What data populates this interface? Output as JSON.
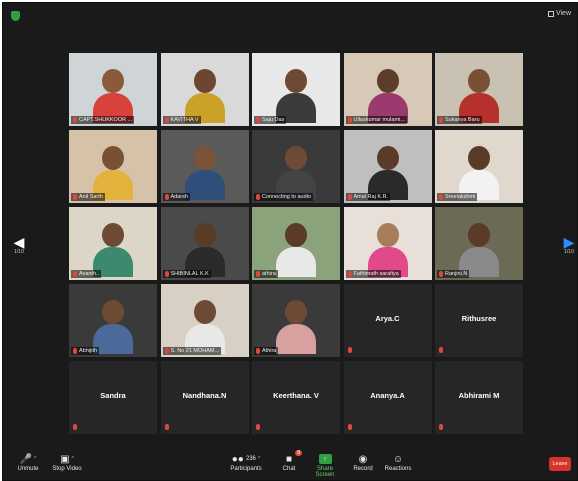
{
  "topbar": {
    "view_label": "View"
  },
  "page": {
    "left_indicator": "1/10",
    "right_indicator": "1/10"
  },
  "tiles": [
    {
      "name": "CAPT.SHUKKOOR ...",
      "kind": "video",
      "bg": "#cfd4d6",
      "skin": "#8a5a3b",
      "shirt": "#d9413b"
    },
    {
      "name": "KAVITHA V",
      "kind": "video",
      "bg": "#d9d9d9",
      "skin": "#6b4630",
      "shirt": "#c9a227"
    },
    {
      "name": "Saju Das",
      "kind": "video",
      "active": true,
      "bg": "#e8e8e8",
      "skin": "#6d4a34",
      "shirt": "#3b3b3b"
    },
    {
      "name": "Ullaskumar mulami...",
      "kind": "video",
      "bg": "#d8c8b8",
      "skin": "#5e3c2a",
      "shirt": "#9b3a6e"
    },
    {
      "name": "Sukanya Baru",
      "kind": "video",
      "bg": "#c9c2b3",
      "skin": "#7a5035",
      "shirt": "#b6302c"
    },
    {
      "name": "Anil Sarth",
      "kind": "video",
      "bg": "#d6c2a8",
      "skin": "#7a5035",
      "shirt": "#e3b23c"
    },
    {
      "name": "Adarsh",
      "kind": "video",
      "bg": "#5a5a5a",
      "skin": "#7b5438",
      "shirt": "#2f4f7a"
    },
    {
      "name": "Connecting to audio",
      "kind": "video",
      "bg": "#3a3a3a",
      "skin": "#6d4a34",
      "shirt": "#444444"
    },
    {
      "name": "Amal Raj K.R.",
      "kind": "video",
      "bg": "#bfbfbf",
      "skin": "#5a3b28",
      "shirt": "#2a2a2a"
    },
    {
      "name": "Sreelakshmi",
      "kind": "video",
      "bg": "#e0d8cc",
      "skin": "#5a3b28",
      "shirt": "#f2f2f2"
    },
    {
      "name": "Avanth..",
      "kind": "video",
      "bg": "#dcd6c8",
      "skin": "#6d4a34",
      "shirt": "#3c8a6d"
    },
    {
      "name": "SHIBINLAL K.K",
      "kind": "video",
      "bg": "#4a4a4a",
      "skin": "#5a3b28",
      "shirt": "#2a2a2a"
    },
    {
      "name": "athira",
      "kind": "video",
      "bg": "#8aa37a",
      "skin": "#5a3b28",
      "shirt": "#e8e8e8"
    },
    {
      "name": "Fathimath sarafiya",
      "kind": "video",
      "bg": "#e8e0d8",
      "skin": "#a67c5a",
      "shirt": "#e04a8a"
    },
    {
      "name": "Ranjini.N",
      "kind": "video",
      "bg": "#6b6b55",
      "skin": "#5a3b28",
      "shirt": "#8a8a8a"
    },
    {
      "name": "Abhijith",
      "kind": "video",
      "bg": "#3a3a3a",
      "skin": "#6d4a34",
      "shirt": "#4a6a9a"
    },
    {
      "name": "S. No 21 MOHAM...",
      "kind": "video",
      "bg": "#d8d0c4",
      "skin": "#6d4a34",
      "shirt": "#e8e8e8"
    },
    {
      "name": "Athira",
      "kind": "video",
      "bg": "#3a3a3a",
      "skin": "#6d4a34",
      "shirt": "#d9a0a0"
    },
    {
      "name": "Arya.C",
      "kind": "name"
    },
    {
      "name": "Rithusree",
      "kind": "name"
    },
    {
      "name": "Sandra",
      "kind": "name"
    },
    {
      "name": "Nandhana.N",
      "kind": "name"
    },
    {
      "name": "Keerthana. V",
      "kind": "name"
    },
    {
      "name": "Ananya.A",
      "kind": "name"
    },
    {
      "name": "Abhirami M",
      "kind": "name"
    }
  ],
  "toolbar": {
    "unmute": "Unmute",
    "stop_video": "Stop Video",
    "participants": "Participants",
    "participants_count": "236",
    "chat": "Chat",
    "chat_badge": "8",
    "share_screen": "Share Screen",
    "record": "Record",
    "reactions": "Reactions",
    "leave": "Leave"
  },
  "colors": {
    "background": "#1a1a1a",
    "tile": "#262626",
    "active_border": "#8bd000",
    "leave": "#d7322b",
    "share": "#2ea043"
  }
}
